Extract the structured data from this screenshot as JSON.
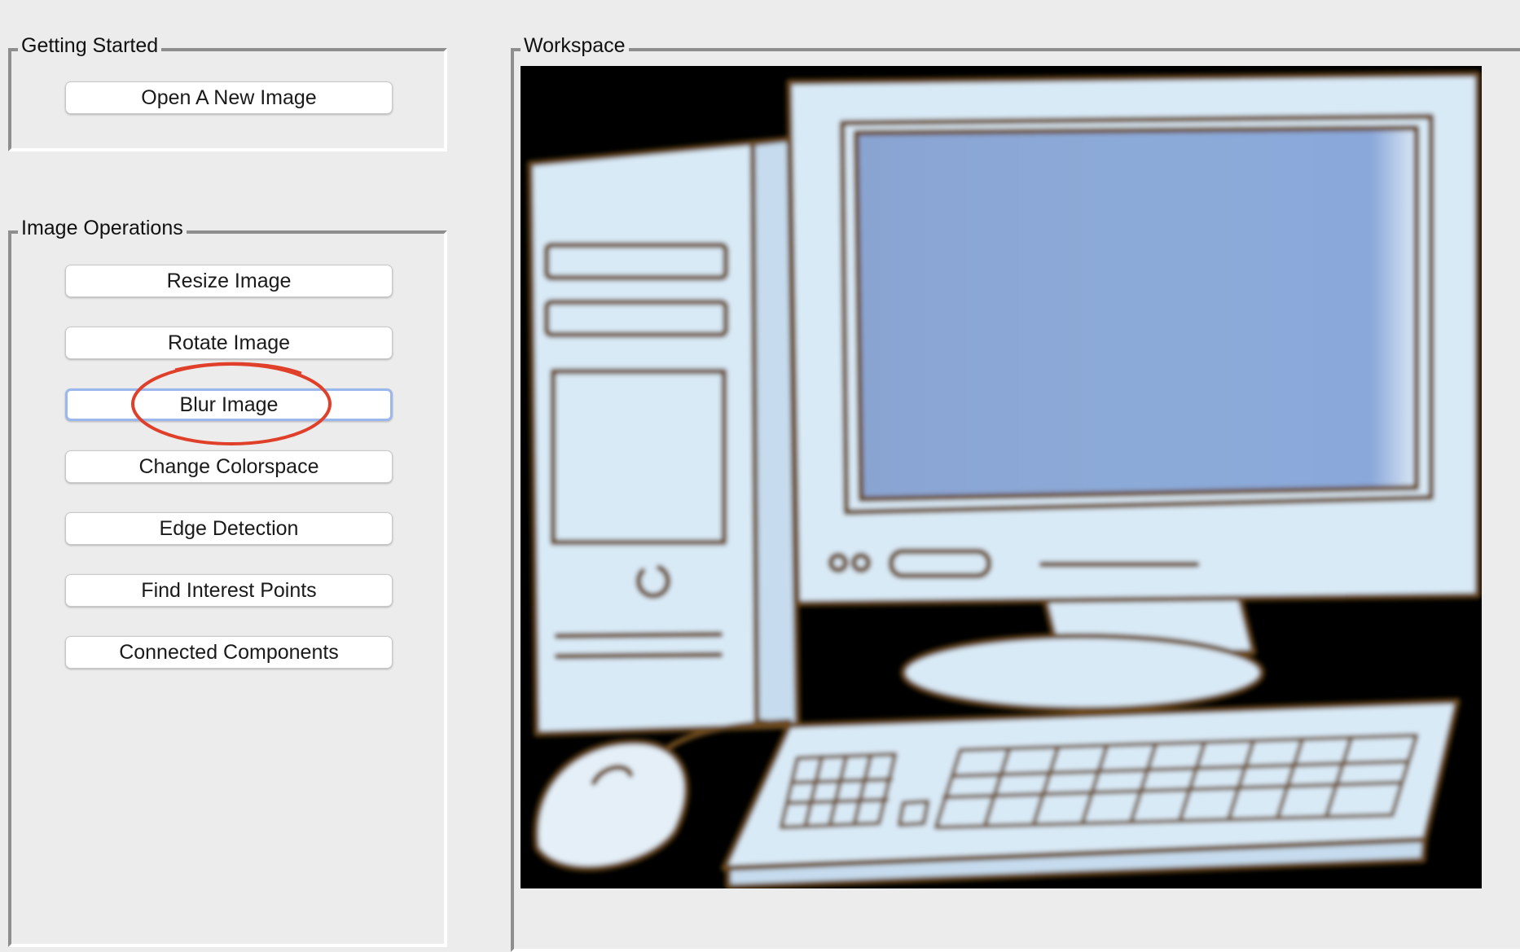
{
  "getting_started": {
    "title": "Getting Started",
    "buttons": [
      "Open A New Image"
    ]
  },
  "image_operations": {
    "title": "Image Operations",
    "buttons": [
      "Resize Image",
      "Rotate Image",
      "Blur Image",
      "Change Colorspace",
      "Edge Detection",
      "Find Interest Points",
      "Connected Components"
    ],
    "focused_button": "Blur Image"
  },
  "workspace": {
    "title": "Workspace",
    "image": "blurred-desktop-computer-illustration"
  },
  "annotation": {
    "shape": "red-circle",
    "target": "Blur Image",
    "color": "#e0402a"
  },
  "colors": {
    "background": "#ececec",
    "focus_ring": "#9ab8ee",
    "annotation": "#e0402a",
    "screen": "#8aa8d8",
    "device_body": "#d9eaf7",
    "outline": "#6b4a1e"
  }
}
